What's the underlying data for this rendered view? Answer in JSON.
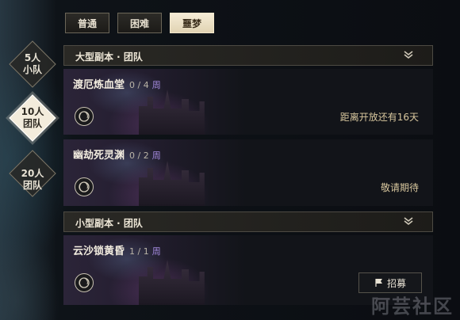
{
  "tabs": [
    {
      "label": "普通",
      "active": false
    },
    {
      "label": "困难",
      "active": false
    },
    {
      "label": "噩梦",
      "active": true
    }
  ],
  "modes": [
    {
      "line1": "5人",
      "line2": "小队",
      "active": false
    },
    {
      "line1": "10人",
      "line2": "团队",
      "active": true
    },
    {
      "line1": "20人",
      "line2": "团队",
      "active": false
    }
  ],
  "sections": [
    {
      "title": "大型副本 · 团队"
    },
    {
      "title": "小型副本 · 团队"
    }
  ],
  "dungeons": [
    {
      "name": "渡厄炼血堂",
      "count": "0 / 4",
      "unit": "周",
      "status": "距离开放还有16天"
    },
    {
      "name": "幽劫死灵渊",
      "count": "0 / 2",
      "unit": "周",
      "status": "敬请期待"
    },
    {
      "name": "云沙锁黄昏",
      "count": "1 / 1",
      "unit": "周",
      "status": ""
    }
  ],
  "recruit_label": "招募",
  "watermark": "阿芸社区",
  "icons": {
    "chevron": "chevron-down-icon",
    "emblem": "swirl-emblem-icon",
    "recruit": "flag-icon"
  },
  "colors": {
    "accent_week": "#a58be0",
    "status_gold": "#d8c79e",
    "tab_active_bg": "#f0e6cc"
  }
}
